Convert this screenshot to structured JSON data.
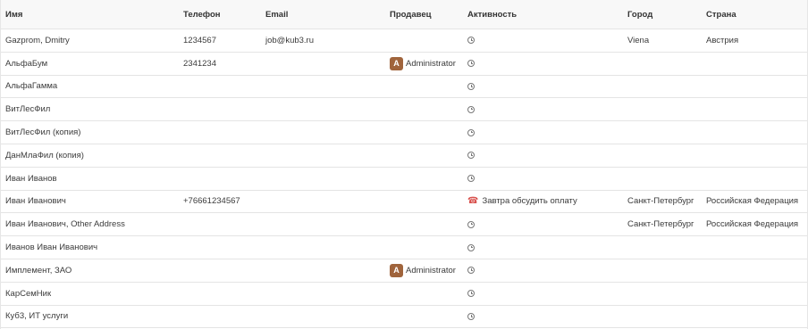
{
  "columns": {
    "name": "Имя",
    "phone": "Телефон",
    "email": "Email",
    "seller": "Продавец",
    "activity": "Активность",
    "city": "Город",
    "country": "Страна"
  },
  "colors": {
    "avatar_bg": "#a0643c",
    "call_icon": "#d9534f",
    "header_bg": "#f8f8f8",
    "row_border": "#e4e4e4"
  },
  "rows": [
    {
      "name": "Gazprom, Dmitry",
      "phone": "1234567",
      "email": "job@kub3.ru",
      "seller_initial": "",
      "seller": "",
      "activity_icon": "clock-icon",
      "activity": "",
      "city": "Viena",
      "country": "Австрия"
    },
    {
      "name": "АльфаБум",
      "phone": "2341234",
      "email": "",
      "seller_initial": "A",
      "seller": "Administrator",
      "activity_icon": "clock-icon",
      "activity": "",
      "city": "",
      "country": ""
    },
    {
      "name": "АльфаГамма",
      "phone": "",
      "email": "",
      "seller_initial": "",
      "seller": "",
      "activity_icon": "clock-icon",
      "activity": "",
      "city": "",
      "country": ""
    },
    {
      "name": "ВитЛесФил",
      "phone": "",
      "email": "",
      "seller_initial": "",
      "seller": "",
      "activity_icon": "clock-icon",
      "activity": "",
      "city": "",
      "country": ""
    },
    {
      "name": "ВитЛесФил (копия)",
      "phone": "",
      "email": "",
      "seller_initial": "",
      "seller": "",
      "activity_icon": "clock-icon",
      "activity": "",
      "city": "",
      "country": ""
    },
    {
      "name": "ДанМлаФил (копия)",
      "phone": "",
      "email": "",
      "seller_initial": "",
      "seller": "",
      "activity_icon": "clock-icon",
      "activity": "",
      "city": "",
      "country": ""
    },
    {
      "name": "Иван Иванов",
      "phone": "",
      "email": "",
      "seller_initial": "",
      "seller": "",
      "activity_icon": "clock-icon",
      "activity": "",
      "city": "",
      "country": ""
    },
    {
      "name": "Иван Иванович",
      "phone": "+76661234567",
      "email": "",
      "seller_initial": "",
      "seller": "",
      "activity_icon": "phone-icon",
      "activity": "Завтра обсудить оплату",
      "city": "Санкт-Петербург",
      "country": "Российская Федерация"
    },
    {
      "name": "Иван Иванович, Other Address",
      "phone": "",
      "email": "",
      "seller_initial": "",
      "seller": "",
      "activity_icon": "clock-icon",
      "activity": "",
      "city": "Санкт-Петербург",
      "country": "Российская Федерация"
    },
    {
      "name": "Иванов Иван Иванович",
      "phone": "",
      "email": "",
      "seller_initial": "",
      "seller": "",
      "activity_icon": "clock-icon",
      "activity": "",
      "city": "",
      "country": ""
    },
    {
      "name": "Имплемент, ЗАО",
      "phone": "",
      "email": "",
      "seller_initial": "A",
      "seller": "Administrator",
      "activity_icon": "clock-icon",
      "activity": "",
      "city": "",
      "country": ""
    },
    {
      "name": "КарСемНик",
      "phone": "",
      "email": "",
      "seller_initial": "",
      "seller": "",
      "activity_icon": "clock-icon",
      "activity": "",
      "city": "",
      "country": ""
    },
    {
      "name": "Куб3, ИТ услуги",
      "phone": "",
      "email": "",
      "seller_initial": "",
      "seller": "",
      "activity_icon": "clock-icon",
      "activity": "",
      "city": "",
      "country": ""
    }
  ]
}
